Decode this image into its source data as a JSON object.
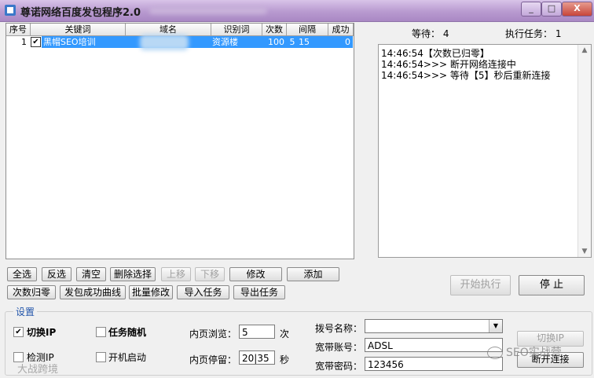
{
  "window": {
    "title": "尊诺网络百度发包程序2.0",
    "minimize": "_",
    "maximize": "□",
    "close": "X"
  },
  "table": {
    "headers": [
      "序号",
      "关键词",
      "域名",
      "识别词",
      "次数",
      "间隔",
      "成功"
    ],
    "rows": [
      {
        "index": "1",
        "checked": "✔",
        "keyword": "黑帽SEO培训",
        "domain": "",
        "id_word": "资源楼",
        "count": "100",
        "interval_a": "5",
        "interval_b": "15",
        "success": "0"
      }
    ]
  },
  "status": {
    "waiting": "等待： 4",
    "running": "执行任务： 1"
  },
  "log": [
    "14:46:54【次数已归零】",
    "14:46:54>>> 断开网络连接中",
    "14:46:54>>> 等待【5】秒后重新连接"
  ],
  "buttons_row1": [
    "全选",
    "反选",
    "清空",
    "删除选择",
    "上移",
    "下移",
    "修改",
    "添加"
  ],
  "buttons_row2": [
    "次数归零",
    "发包成功曲线",
    "批量修改",
    "导入任务",
    "导出任务"
  ],
  "actions": {
    "start": "开始执行",
    "stop": "停 止"
  },
  "settings": {
    "group_label": "设置",
    "switch_ip": "切换IP",
    "switch_ip_checked": "✔",
    "random_task": "任务随机",
    "detect_ip": "检测IP",
    "autostart": "开机启动",
    "inner_browse_label": "内页浏览：",
    "inner_browse_value": "5",
    "inner_browse_unit": "次",
    "inner_stay_label": "内页停留：",
    "inner_stay_value": "20|35",
    "inner_stay_unit": "秒",
    "dial_name_label": "拨号名称：",
    "dial_name_value": "",
    "broadband_account_label": "宽带账号：",
    "broadband_account_value": "ADSL",
    "broadband_password_label": "宽带密码：",
    "broadband_password_value": "123456",
    "switch_ip_button": "切换IP",
    "disconnect_button": "断开连接"
  },
  "watermarks": {
    "right": "SEO实战营",
    "left": "大战跨境"
  }
}
